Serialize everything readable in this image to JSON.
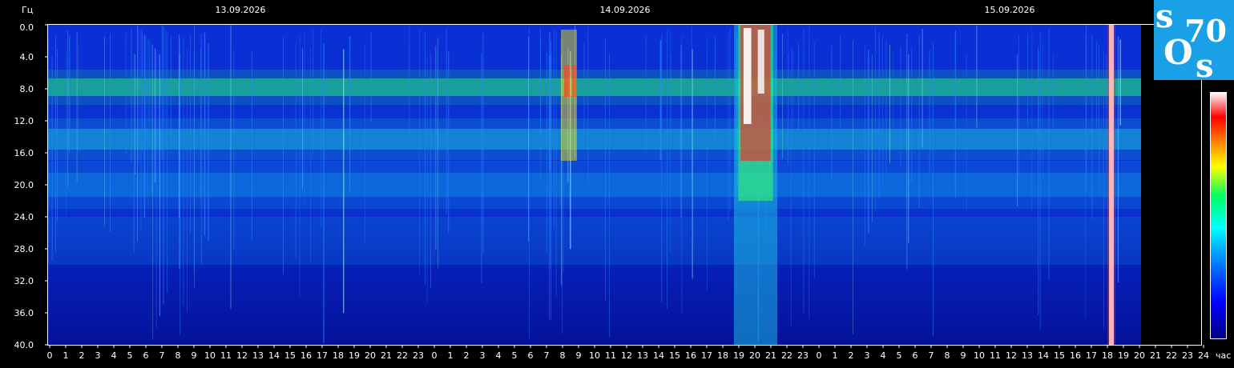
{
  "chart_data": {
    "type": "heatmap",
    "y_unit": "Гц",
    "x_unit": "час",
    "dates": [
      "13.09.2026",
      "14.09.2026",
      "15.09.2026"
    ],
    "y_ticks": [
      "0.0",
      "4.0",
      "8.0",
      "12.0",
      "16.0",
      "20.0",
      "24.0",
      "28.0",
      "32.0",
      "36.0",
      "40.0"
    ],
    "ylim": [
      0,
      40
    ],
    "x_ticks": [
      "0",
      "1",
      "2",
      "3",
      "4",
      "5",
      "6",
      "7",
      "8",
      "9",
      "10",
      "11",
      "12",
      "13",
      "14",
      "15",
      "16",
      "17",
      "18",
      "19",
      "20",
      "21",
      "22",
      "23",
      "0",
      "1",
      "2",
      "3",
      "4",
      "5",
      "6",
      "7",
      "8",
      "9",
      "10",
      "11",
      "12",
      "13",
      "14",
      "15",
      "16",
      "17",
      "18",
      "19",
      "20",
      "21",
      "22",
      "23",
      "0",
      "1",
      "2",
      "3",
      "4",
      "5",
      "6",
      "7",
      "8",
      "9",
      "10",
      "11",
      "12",
      "13",
      "14",
      "15",
      "16",
      "17",
      "18",
      "19",
      "20",
      "21",
      "22",
      "23",
      "24"
    ],
    "data_end_hour": 68.2,
    "resonance_bands_hz": [
      7.8,
      14.3,
      20.0
    ],
    "bursts": [
      {
        "start_hour": 42.8,
        "end_hour": 45.5,
        "intensity": "high",
        "max_hz": 40
      },
      {
        "start_hour": 32.0,
        "end_hour": 33.0,
        "intensity": "high",
        "max_hz": 17
      },
      {
        "start_hour": 66.2,
        "end_hour": 66.5,
        "intensity": "peak",
        "max_hz": 40
      }
    ],
    "colorscale": [
      "#000080",
      "#0000ff",
      "#00a0ff",
      "#00ffff",
      "#00ff60",
      "#ffff00",
      "#ff8000",
      "#ff0000",
      "#ffffff"
    ],
    "grid": false
  },
  "logo": {
    "letters": [
      "s",
      "O",
      "s"
    ],
    "number": "70",
    "bg_color": "#1aa0e6"
  }
}
